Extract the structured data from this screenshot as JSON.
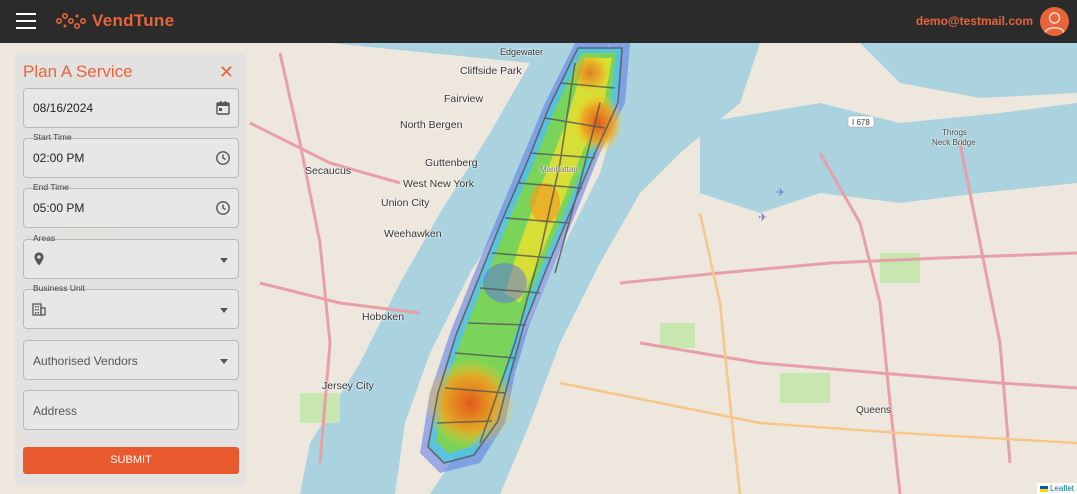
{
  "header": {
    "brand": "VendTune",
    "user_email": "demo@testmail.com"
  },
  "form": {
    "title": "Plan A Service",
    "date": {
      "value": "08/16/2024"
    },
    "start_time": {
      "label": "Start Time",
      "value": "02:00 PM"
    },
    "end_time": {
      "label": "End Time",
      "value": "05:00 PM"
    },
    "areas": {
      "label": "Areas",
      "value": ""
    },
    "business_unit": {
      "label": "Business Unit",
      "value": ""
    },
    "authorised_vendors": {
      "placeholder": "Authorised Vendors"
    },
    "address": {
      "placeholder": "Address"
    },
    "submit_label": "SUBMIT"
  },
  "map": {
    "labels": {
      "edgewater": "Edgewater",
      "cliffside_park": "Cliffside Park",
      "fairview": "Fairview",
      "north_bergen": "North Bergen",
      "guttenberg": "Guttenberg",
      "secaucus": "Secaucus",
      "west_new_york": "West New York",
      "union_city": "Union City",
      "weehawken": "Weehawken",
      "hoboken": "Hoboken",
      "jersey_city": "Jersey City",
      "throgs_neck_bridge_1": "Throgs",
      "throgs_neck_bridge_2": "Neck Bridge",
      "queens": "Queens",
      "manhattan": "Manhattan",
      "i678": "I 678"
    },
    "attribution": "Leaflet"
  }
}
